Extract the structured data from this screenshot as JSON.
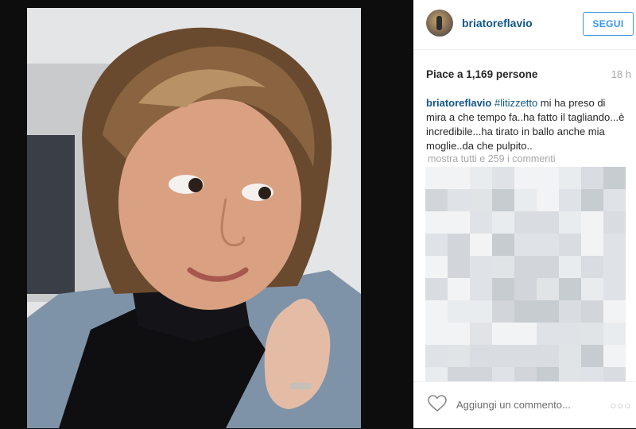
{
  "post": {
    "username": "briatoreflavio",
    "follow_label": "SEGUI",
    "likes": "Piace a 1,169 persone",
    "timestamp": "18 h",
    "caption": {
      "user": "briatoreflavio",
      "hashtag": "#litizzetto",
      "text": " mi ha preso di mira a che tempo fa..ha fatto il tagliando...è incredibile...ha tirato in ballo anche mia moglie..da che pulpito.."
    },
    "view_all_comments": "mostra tutti e 259 i commenti",
    "add_comment_placeholder": "Aggiungi un commento...",
    "icons": {
      "like": "heart-icon",
      "options": "more-options-icon",
      "avatar": "profile-avatar"
    }
  },
  "colors": {
    "link": "#125688",
    "follow": "#3897f0",
    "muted": "#a5a7aa"
  }
}
